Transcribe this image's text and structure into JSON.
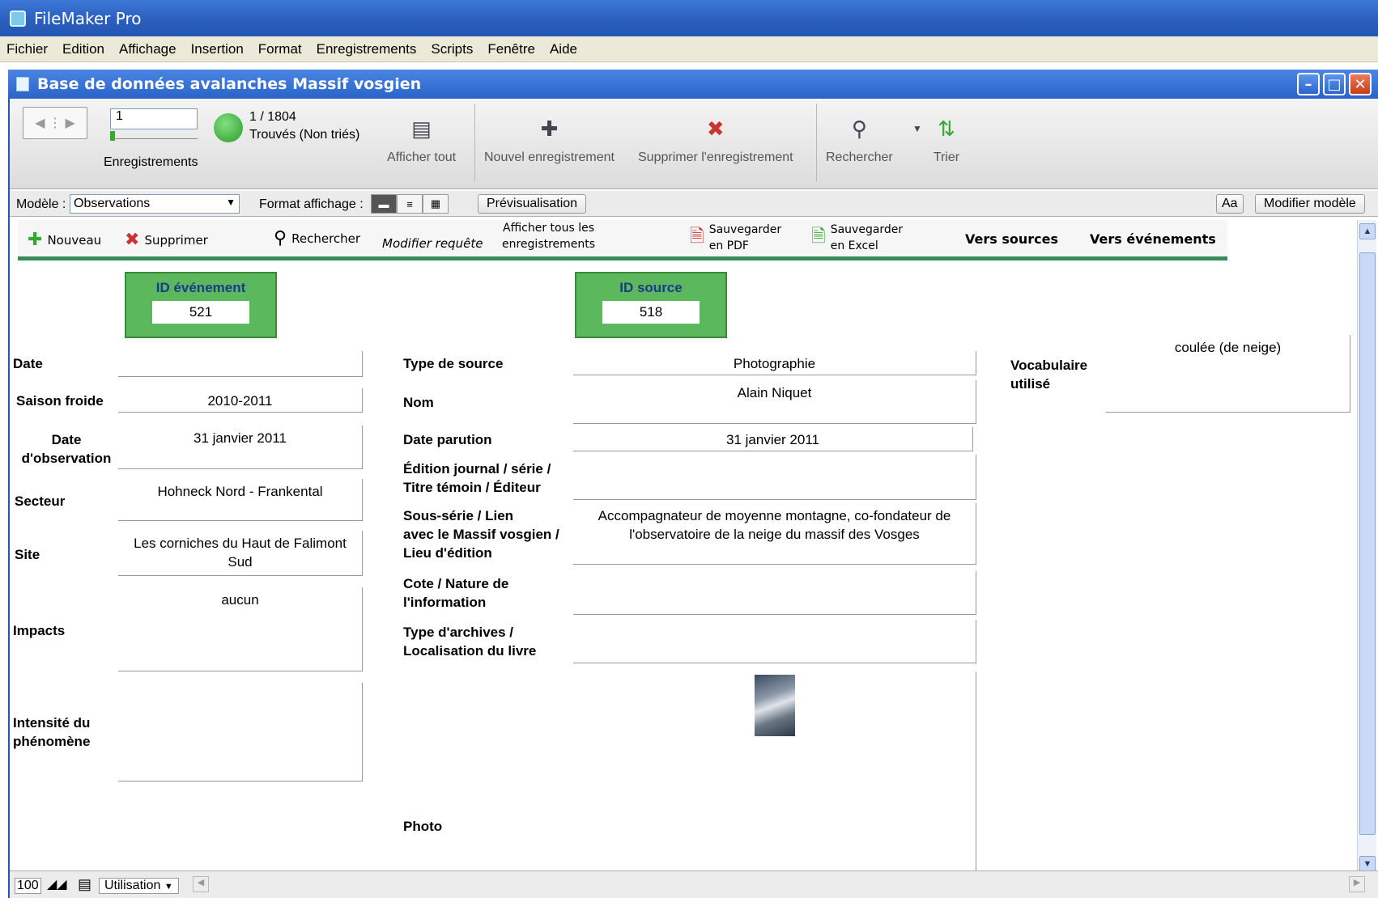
{
  "app": {
    "title": "FileMaker Pro"
  },
  "menu": [
    "Fichier",
    "Edition",
    "Affichage",
    "Insertion",
    "Format",
    "Enregistrements",
    "Scripts",
    "Fenêtre",
    "Aide"
  ],
  "window": {
    "title": "Base de données avalanches Massif vosgien"
  },
  "toolbar": {
    "record_value": "1",
    "records_label": "Enregistrements",
    "found_count": "1 / 1804",
    "found_status": "Trouvés (Non triés)",
    "show_all": "Afficher tout",
    "new_record": "Nouvel enregistrement",
    "delete_record": "Supprimer l'enregistrement",
    "find": "Rechercher",
    "sort": "Trier"
  },
  "layoutbar": {
    "layout_label": "Modèle :",
    "layout_value": "Observations",
    "view_label": "Format affichage :",
    "preview": "Prévisualisation",
    "text_btn": "Aa",
    "edit_layout": "Modifier modèle"
  },
  "custom_bar": {
    "new": "Nouveau",
    "delete": "Supprimer",
    "find": "Rechercher",
    "modify_request": "Modifier requête",
    "show_all_1": "Afficher tous les",
    "show_all_2": "enregistrements",
    "pdf_1": "Sauvegarder",
    "pdf_2": "en PDF",
    "excel_1": "Sauvegarder",
    "excel_2": "en Excel",
    "to_sources": "Vers sources",
    "to_events": "Vers événements"
  },
  "ids": {
    "event_label": "ID événement",
    "event_value": "521",
    "source_label": "ID source",
    "source_value": "518"
  },
  "event": {
    "date_label": "Date",
    "date_value": "",
    "season_label": "Saison froide",
    "season_value": "2010-2011",
    "obs_date_label_1": "Date",
    "obs_date_label_2": "d'observation",
    "obs_date_value": "31 janvier 2011",
    "sector_label": "Secteur",
    "sector_value": "Hohneck Nord - Frankental",
    "site_label": "Site",
    "site_value": "Les corniches du Haut de Falimont Sud",
    "impacts_label": "Impacts",
    "impacts_value": "aucun",
    "intensity_label_1": "Intensité du",
    "intensity_label_2": "phénomène",
    "intensity_value": ""
  },
  "source": {
    "type_label": "Type de source",
    "type_value": "Photographie",
    "name_label": "Nom",
    "name_value": "Alain Niquet",
    "pub_date_label": "Date parution",
    "pub_date_value": "31 janvier 2011",
    "edition_label_1": "Édition journal / série /",
    "edition_label_2": "Titre témoin / Éditeur",
    "edition_value": "",
    "subseries_label_1": "Sous-série / Lien",
    "subseries_label_2": "avec le Massif vosgien /",
    "subseries_label_3": "Lieu d'édition",
    "subseries_value": "Accompagnateur de moyenne montagne, co-fondateur de l'observatoire de la neige du massif des Vosges",
    "cote_label_1": "Cote / Nature de",
    "cote_label_2": "l'information",
    "cote_value": "",
    "archives_label_1": "Type d'archives /",
    "archives_label_2": "Localisation du livre",
    "archives_value": "",
    "photo_label": "Photo"
  },
  "vocab": {
    "label_1": "Vocabulaire",
    "label_2": "utilisé",
    "value": "coulée (de neige)"
  },
  "status": {
    "zoom": "100",
    "mode": "Utilisation"
  }
}
